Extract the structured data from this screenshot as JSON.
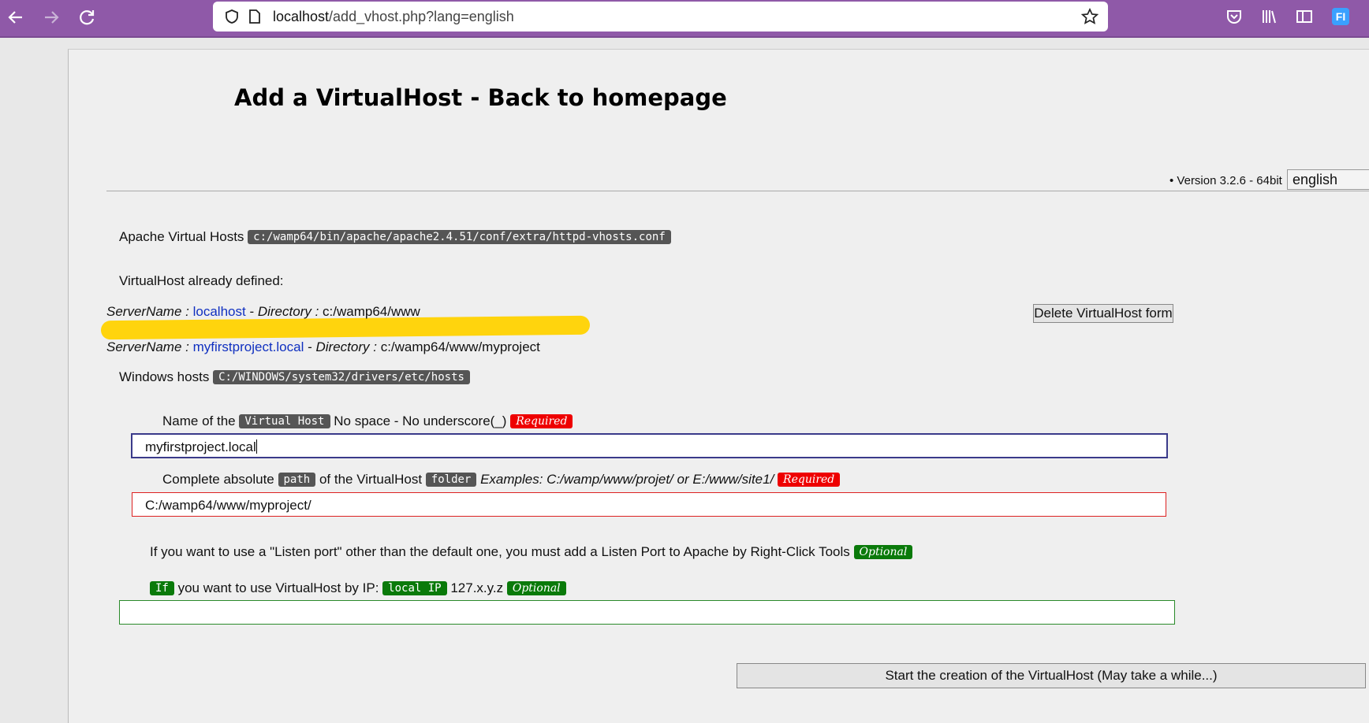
{
  "browser": {
    "url_host": "localhost",
    "url_path": "/add_vhost.php?lang=english"
  },
  "page": {
    "title": "Add a VirtualHost - Back to homepage",
    "version": "• Version 3.2.6 - 64bit",
    "language": "english"
  },
  "vhosts_file": {
    "label": "Apache Virtual Hosts",
    "path": "c:/wamp64/bin/apache/apache2.4.51/conf/extra/httpd-vhosts.conf"
  },
  "defined": {
    "heading": "VirtualHost already defined:",
    "server_label": "ServerName :",
    "dir_label": "Directory :",
    "entries": [
      {
        "server": "localhost",
        "directory": "c:/wamp64/www"
      },
      {
        "server": "myfirstproject.local",
        "directory": "c:/wamp64/www/myproject"
      }
    ],
    "delete_button": "Delete VirtualHost form"
  },
  "windows_hosts": {
    "label": "Windows hosts",
    "path": "C:/WINDOWS/system32/drivers/etc/hosts"
  },
  "form": {
    "name_prefix": "Name of the",
    "name_badge": "Virtual Host",
    "name_suffix": "No space - No underscore(_)",
    "required": "Required",
    "name_value": "myfirstproject.local",
    "path_prefix": "Complete absolute",
    "path_badge": "path",
    "path_mid": "of the VirtualHost",
    "folder_badge": "folder",
    "path_examples": "Examples: C:/wamp/www/projet/ or E:/www/site1/",
    "path_value": "C:/wamp64/www/myproject/",
    "port_text": "If you want to use a \"Listen port\" other than the default one, you must add a Listen Port to Apache by Right-Click Tools",
    "optional": "Optional",
    "ip_if": "If",
    "ip_text": "you want to use VirtualHost by IP:",
    "ip_badge": "local IP",
    "ip_pattern": "127.x.y.z",
    "ip_value": "",
    "submit_button": "Start the creation of the VirtualHost (May take a while...)"
  }
}
